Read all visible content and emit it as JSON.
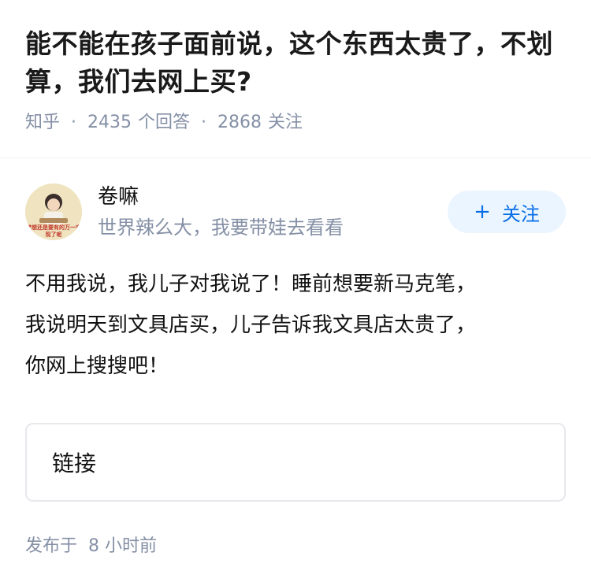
{
  "question": {
    "title": "能不能在孩子面前说，这个东西太贵了，不划算，我们去网上买?",
    "source": "知乎",
    "answers_count": "2435",
    "answers_label": "个回答",
    "followers_count": "2868",
    "followers_label": "关注"
  },
  "answer": {
    "author": {
      "name": "卷嘛",
      "bio": "世界辣么大，我要带娃去看看",
      "avatar_text": "梦想还是要有的万一实现了呢",
      "avatar_icon": "avatar-illustration"
    },
    "follow_button": {
      "plus": "+",
      "label": "关注"
    },
    "content_lines": [
      "不用我说，我儿子对我说了！睡前想要新马克笔，",
      "我说明天到文具店买，儿子告诉我文具店太贵了，",
      "你网上搜搜吧！"
    ],
    "link_card": {
      "label": "链接"
    },
    "publish": {
      "label": "发布于",
      "time": "8 小时前"
    }
  },
  "colors": {
    "meta_gray": "#8590a6",
    "follow_bg": "#ebf5ff",
    "follow_text": "#056de8",
    "card_border": "#e7e8ec"
  }
}
